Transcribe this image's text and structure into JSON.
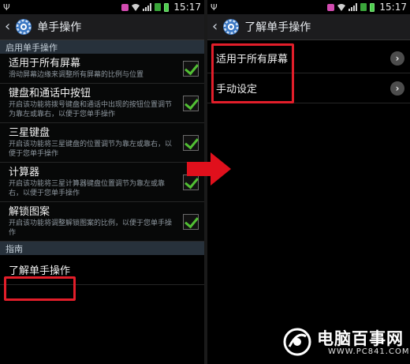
{
  "status": {
    "time": "15:17"
  },
  "left": {
    "title": "单手操作",
    "section_enable": "启用单手操作",
    "items": [
      {
        "title": "适用于所有屏幕",
        "subtitle": "滑动屏幕边缘来调整所有屏幕的比例与位置",
        "checked": true
      },
      {
        "title": "键盘和通话中按钮",
        "subtitle": "开启该功能将拨号键盘和通话中出现的按钮位置调节为靠左或靠右，以便于您单手操作",
        "checked": true
      },
      {
        "title": "三星键盘",
        "subtitle": "开启该功能将三星键盘的位置调节为靠左或靠右，以便于您单手操作",
        "checked": true
      },
      {
        "title": "计算器",
        "subtitle": "开启该功能将三星计算器键盘位置调节为靠左或靠右，以便于您单手操作",
        "checked": true
      },
      {
        "title": "解锁图案",
        "subtitle": "开启该功能将调整解锁图案的比例，以便于您单手操作",
        "checked": true
      }
    ],
    "section_guide": "指南",
    "guide_item": "了解单手操作"
  },
  "right": {
    "title": "了解单手操作",
    "items": [
      {
        "label": "适用于所有屏幕"
      },
      {
        "label": "手动设定"
      }
    ]
  },
  "watermark": {
    "text": "电脑百事网",
    "url": "WWW.PC841.COM"
  },
  "colors": {
    "highlight": "#e21e2a",
    "check": "#52c034",
    "section_bg": "#27313b"
  }
}
